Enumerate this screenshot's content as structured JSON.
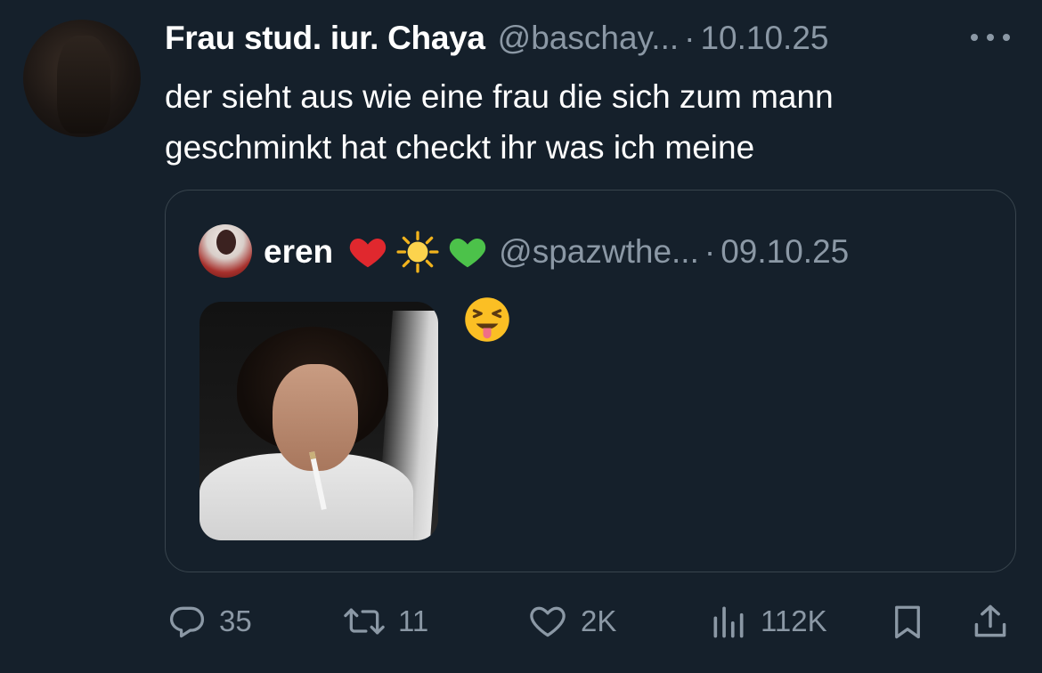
{
  "tweet": {
    "author_name": "Frau stud. iur. Chaya",
    "author_handle": "@baschay...",
    "separator": "·",
    "date": "10.10.25",
    "text": "der sieht aus wie eine frau die sich zum mann\ngeschminkt hat checkt ihr was ich meine",
    "more_icon": "more-horizontal-icon"
  },
  "quoted_tweet": {
    "author_name": "eren",
    "name_emojis": [
      "red-heart-emoji",
      "sun-emoji",
      "green-heart-emoji"
    ],
    "author_handle": "@spazwthe...",
    "separator": "·",
    "date": "09.10.25",
    "text_emoji": "squinting-face-with-tongue-emoji"
  },
  "actions": {
    "reply": {
      "icon": "reply-icon",
      "count": "35"
    },
    "retweet": {
      "icon": "retweet-icon",
      "count": "11"
    },
    "like": {
      "icon": "heart-icon",
      "count": "2K"
    },
    "views": {
      "icon": "views-bar-chart-icon",
      "count": "112K"
    },
    "bookmark": {
      "icon": "bookmark-icon"
    },
    "share": {
      "icon": "share-icon"
    }
  },
  "colors": {
    "background": "#15202b",
    "text_primary": "#ffffff",
    "text_secondary": "#8b98a5",
    "border": "#38444d"
  }
}
